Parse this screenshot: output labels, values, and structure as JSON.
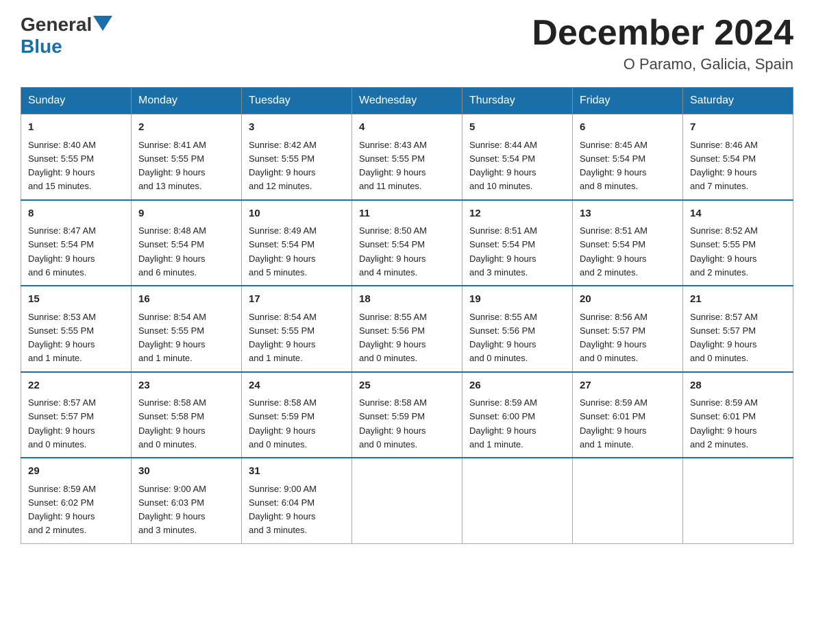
{
  "header": {
    "logo_general": "General",
    "logo_blue": "Blue",
    "month_title": "December 2024",
    "location": "O Paramo, Galicia, Spain"
  },
  "weekdays": [
    "Sunday",
    "Monday",
    "Tuesday",
    "Wednesday",
    "Thursday",
    "Friday",
    "Saturday"
  ],
  "weeks": [
    [
      {
        "day": "1",
        "sunrise": "8:40 AM",
        "sunset": "5:55 PM",
        "daylight": "9 hours and 15 minutes."
      },
      {
        "day": "2",
        "sunrise": "8:41 AM",
        "sunset": "5:55 PM",
        "daylight": "9 hours and 13 minutes."
      },
      {
        "day": "3",
        "sunrise": "8:42 AM",
        "sunset": "5:55 PM",
        "daylight": "9 hours and 12 minutes."
      },
      {
        "day": "4",
        "sunrise": "8:43 AM",
        "sunset": "5:55 PM",
        "daylight": "9 hours and 11 minutes."
      },
      {
        "day": "5",
        "sunrise": "8:44 AM",
        "sunset": "5:54 PM",
        "daylight": "9 hours and 10 minutes."
      },
      {
        "day": "6",
        "sunrise": "8:45 AM",
        "sunset": "5:54 PM",
        "daylight": "9 hours and 8 minutes."
      },
      {
        "day": "7",
        "sunrise": "8:46 AM",
        "sunset": "5:54 PM",
        "daylight": "9 hours and 7 minutes."
      }
    ],
    [
      {
        "day": "8",
        "sunrise": "8:47 AM",
        "sunset": "5:54 PM",
        "daylight": "9 hours and 6 minutes."
      },
      {
        "day": "9",
        "sunrise": "8:48 AM",
        "sunset": "5:54 PM",
        "daylight": "9 hours and 6 minutes."
      },
      {
        "day": "10",
        "sunrise": "8:49 AM",
        "sunset": "5:54 PM",
        "daylight": "9 hours and 5 minutes."
      },
      {
        "day": "11",
        "sunrise": "8:50 AM",
        "sunset": "5:54 PM",
        "daylight": "9 hours and 4 minutes."
      },
      {
        "day": "12",
        "sunrise": "8:51 AM",
        "sunset": "5:54 PM",
        "daylight": "9 hours and 3 minutes."
      },
      {
        "day": "13",
        "sunrise": "8:51 AM",
        "sunset": "5:54 PM",
        "daylight": "9 hours and 2 minutes."
      },
      {
        "day": "14",
        "sunrise": "8:52 AM",
        "sunset": "5:55 PM",
        "daylight": "9 hours and 2 minutes."
      }
    ],
    [
      {
        "day": "15",
        "sunrise": "8:53 AM",
        "sunset": "5:55 PM",
        "daylight": "9 hours and 1 minute."
      },
      {
        "day": "16",
        "sunrise": "8:54 AM",
        "sunset": "5:55 PM",
        "daylight": "9 hours and 1 minute."
      },
      {
        "day": "17",
        "sunrise": "8:54 AM",
        "sunset": "5:55 PM",
        "daylight": "9 hours and 1 minute."
      },
      {
        "day": "18",
        "sunrise": "8:55 AM",
        "sunset": "5:56 PM",
        "daylight": "9 hours and 0 minutes."
      },
      {
        "day": "19",
        "sunrise": "8:55 AM",
        "sunset": "5:56 PM",
        "daylight": "9 hours and 0 minutes."
      },
      {
        "day": "20",
        "sunrise": "8:56 AM",
        "sunset": "5:57 PM",
        "daylight": "9 hours and 0 minutes."
      },
      {
        "day": "21",
        "sunrise": "8:57 AM",
        "sunset": "5:57 PM",
        "daylight": "9 hours and 0 minutes."
      }
    ],
    [
      {
        "day": "22",
        "sunrise": "8:57 AM",
        "sunset": "5:57 PM",
        "daylight": "9 hours and 0 minutes."
      },
      {
        "day": "23",
        "sunrise": "8:58 AM",
        "sunset": "5:58 PM",
        "daylight": "9 hours and 0 minutes."
      },
      {
        "day": "24",
        "sunrise": "8:58 AM",
        "sunset": "5:59 PM",
        "daylight": "9 hours and 0 minutes."
      },
      {
        "day": "25",
        "sunrise": "8:58 AM",
        "sunset": "5:59 PM",
        "daylight": "9 hours and 0 minutes."
      },
      {
        "day": "26",
        "sunrise": "8:59 AM",
        "sunset": "6:00 PM",
        "daylight": "9 hours and 1 minute."
      },
      {
        "day": "27",
        "sunrise": "8:59 AM",
        "sunset": "6:01 PM",
        "daylight": "9 hours and 1 minute."
      },
      {
        "day": "28",
        "sunrise": "8:59 AM",
        "sunset": "6:01 PM",
        "daylight": "9 hours and 2 minutes."
      }
    ],
    [
      {
        "day": "29",
        "sunrise": "8:59 AM",
        "sunset": "6:02 PM",
        "daylight": "9 hours and 2 minutes."
      },
      {
        "day": "30",
        "sunrise": "9:00 AM",
        "sunset": "6:03 PM",
        "daylight": "9 hours and 3 minutes."
      },
      {
        "day": "31",
        "sunrise": "9:00 AM",
        "sunset": "6:04 PM",
        "daylight": "9 hours and 3 minutes."
      },
      null,
      null,
      null,
      null
    ]
  ],
  "labels": {
    "sunrise": "Sunrise:",
    "sunset": "Sunset:",
    "daylight": "Daylight:"
  }
}
